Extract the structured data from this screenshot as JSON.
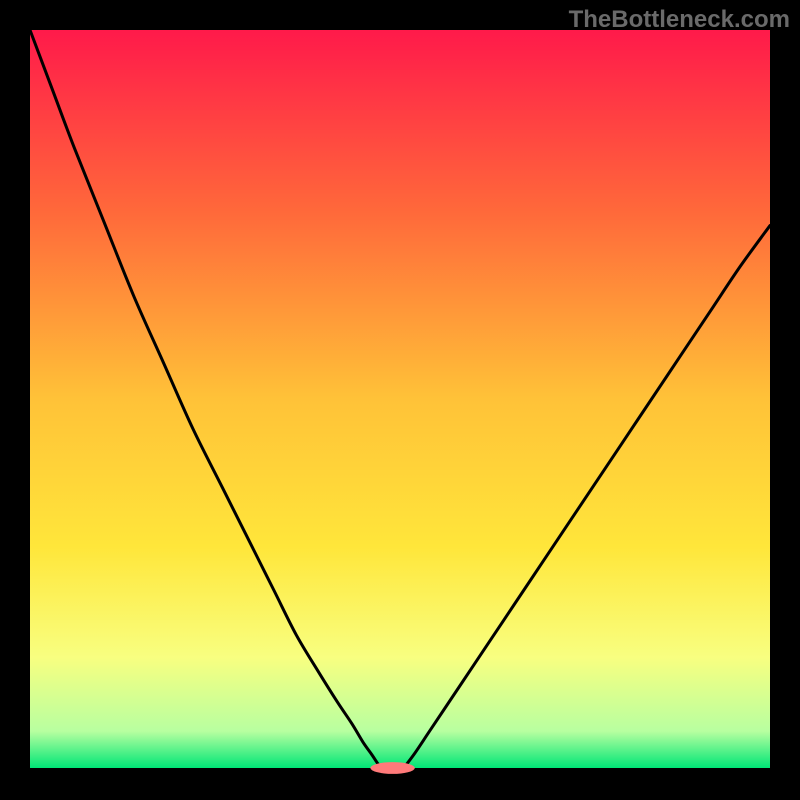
{
  "watermark": {
    "text": "TheBottleneck.com"
  },
  "chart_data": {
    "type": "line",
    "title": "",
    "xlabel": "",
    "ylabel": "",
    "xlim": [
      0,
      100
    ],
    "ylim": [
      0,
      100
    ],
    "grid": false,
    "legend": false,
    "background_gradient": {
      "stops": [
        {
          "offset": 0.0,
          "color": "#ff1a4a"
        },
        {
          "offset": 0.25,
          "color": "#ff6a3a"
        },
        {
          "offset": 0.5,
          "color": "#ffc238"
        },
        {
          "offset": 0.7,
          "color": "#ffe63a"
        },
        {
          "offset": 0.85,
          "color": "#f8ff80"
        },
        {
          "offset": 0.95,
          "color": "#b8ffa0"
        },
        {
          "offset": 1.0,
          "color": "#00e676"
        }
      ]
    },
    "series": [
      {
        "name": "left-curve",
        "color": "#000000",
        "x": [
          0.0,
          3.0,
          6.0,
          10.0,
          14.0,
          18.0,
          22.0,
          26.0,
          30.0,
          33.0,
          36.0,
          39.0,
          41.5,
          43.5,
          45.0,
          46.2,
          47.0,
          47.5
        ],
        "y": [
          100.0,
          92.0,
          84.0,
          74.0,
          64.0,
          55.0,
          46.0,
          38.0,
          30.0,
          24.0,
          18.0,
          13.0,
          9.0,
          6.0,
          3.5,
          1.8,
          0.6,
          0.0
        ]
      },
      {
        "name": "right-curve",
        "color": "#000000",
        "x": [
          50.5,
          52.0,
          54.0,
          57.0,
          60.0,
          64.0,
          68.0,
          72.0,
          76.0,
          80.0,
          84.0,
          88.0,
          92.0,
          96.0,
          100.0
        ],
        "y": [
          0.0,
          2.0,
          5.0,
          9.5,
          14.0,
          20.0,
          26.0,
          32.0,
          38.0,
          44.0,
          50.0,
          56.0,
          62.0,
          68.0,
          73.5
        ]
      }
    ],
    "marker": {
      "name": "optimum-point",
      "cx": 49.0,
      "cy": 0.0,
      "rx": 3.0,
      "ry": 0.8,
      "color": "#ff7a7a"
    }
  }
}
